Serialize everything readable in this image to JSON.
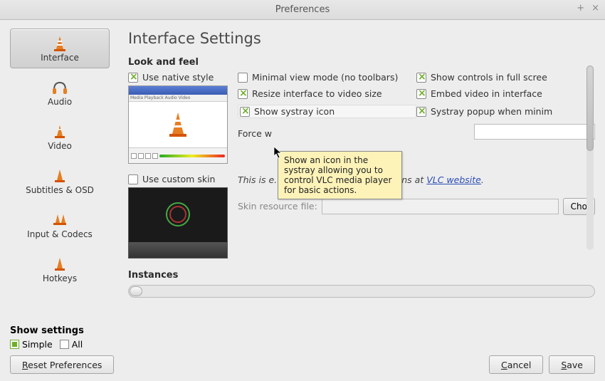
{
  "window": {
    "title": "Preferences"
  },
  "sidebar": {
    "items": [
      {
        "label": "Interface"
      },
      {
        "label": "Audio"
      },
      {
        "label": "Video"
      },
      {
        "label": "Subtitles & OSD"
      },
      {
        "label": "Input & Codecs"
      },
      {
        "label": "Hotkeys"
      }
    ]
  },
  "main": {
    "title": "Interface Settings",
    "sections": {
      "look_feel": {
        "title": "Look and feel"
      },
      "instances": {
        "title": "Instances"
      }
    },
    "look": {
      "native_style": "Use native style",
      "minimal_view": "Minimal view mode (no toolbars)",
      "show_controls_full": "Show controls in full scree",
      "resize_to_video": "Resize interface to video size",
      "embed_video": "Embed video in interface",
      "show_systray": "Show systray icon",
      "systray_popup": "Systray popup when minim",
      "force_label": "Force w"
    },
    "skin": {
      "use_custom": "Use custom skin",
      "note_pre": "This is                                                        e. You can download other skins at",
      "link_text": "VLC website",
      "note_post": ".",
      "file_label": "Skin resource file:",
      "choose_btn": "Cho"
    }
  },
  "tooltip": {
    "text": "Show an icon in the systray allowing you to control VLC media player for basic actions."
  },
  "footer": {
    "show_settings": {
      "label": "Show settings",
      "simple": "Simple",
      "all": "All"
    },
    "reset_rest": "eset Preferences",
    "cancel_rest": "ancel",
    "save_rest": "ave"
  }
}
